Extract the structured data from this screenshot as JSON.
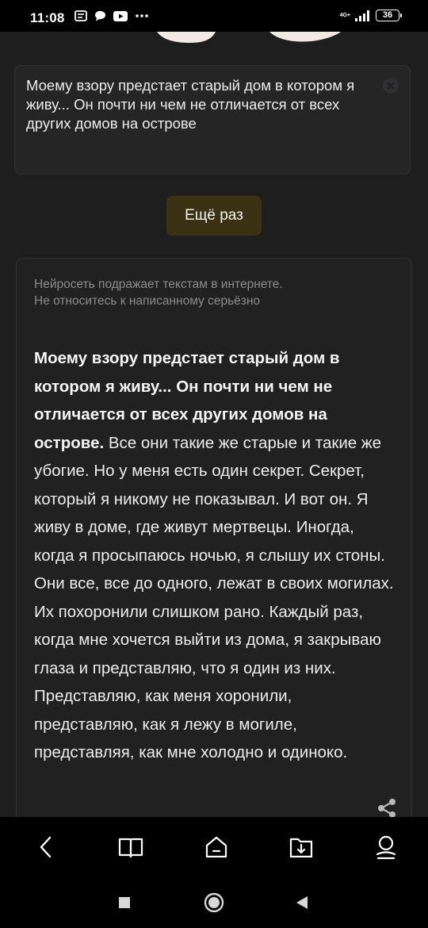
{
  "status_bar": {
    "time": "11:08",
    "network": "4G+",
    "battery": "36",
    "left_icons": [
      "notification-icon",
      "message-icon",
      "youtube-icon",
      "more-dots-icon"
    ]
  },
  "prompt": {
    "text": "Моему взору предстает старый дом в котором я живу... Он почти ни чем не отличается от всех других домов на острове"
  },
  "again_button": {
    "label": "Ещё раз"
  },
  "result": {
    "disclaimer_line1": "Нейросеть подражает текстам в интернете.",
    "disclaimer_line2": "Не относитесь к написанному серьёзно",
    "bold_part": "Моему взору предстает старый дом в котором я живу... Он почти ни чем не отличается от всех других домов на острове.",
    "continuation": " Все они такие же старые и такие же убогие. Но у меня есть один секрет. Секрет, который я никому не показывал. И вот он. Я живу в доме, где живут мертвецы. Иногда, когда я просыпаюсь ночью, я слышу их стоны. Они все, все до одного, лежат в своих могилах. Их похоронили слишком рано. Каждый раз, когда мне хочется выйти из дома, я закрываю глаза и представляю, что я один из них. Представляю, как меня хоронили, представляю, как я лежу в могиле, представляя, как мне холодно и одиноко."
  },
  "app_nav": {
    "items": [
      "back-icon",
      "book-icon",
      "home-icon",
      "download-folder-icon",
      "profile-icon"
    ]
  },
  "system_nav": {
    "items": [
      "recents-square-icon",
      "home-circle-icon",
      "back-triangle-icon"
    ]
  },
  "colors": {
    "background": "#1e1e1f",
    "card": "#252526",
    "button": "#3a3212",
    "muted_text": "#8c8c8c"
  }
}
